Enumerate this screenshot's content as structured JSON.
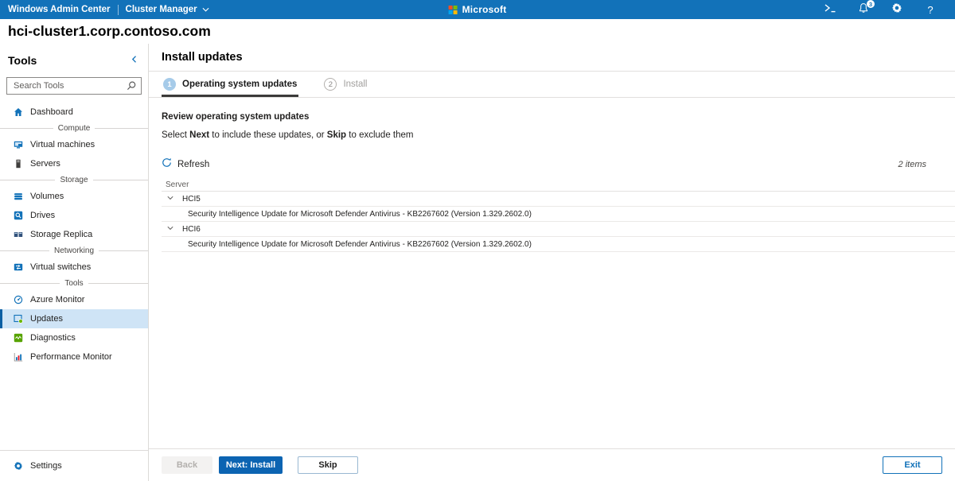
{
  "colors": {
    "topbar_blue": "#1272b9",
    "primary_button_blue": "#0c64b2",
    "selected_item_bg": "#cfe4f6",
    "selected_item_bar": "#0b5fa3",
    "active_step_circle": "#a6cbe9",
    "diagnostics_green": "#57a300",
    "updates_dot_green": "#6bb700"
  },
  "topbar": {
    "app_title": "Windows Admin Center",
    "solution": "Cluster Manager",
    "brand": "Microsoft",
    "notification_count": "3",
    "help_glyph": "?"
  },
  "page": {
    "cluster_name": "hci-cluster1.corp.contoso.com"
  },
  "sidebar": {
    "title": "Tools",
    "search_placeholder": "Search Tools",
    "sections": [
      {
        "label": "",
        "items": [
          {
            "label": "Dashboard",
            "icon": "home-icon"
          }
        ]
      },
      {
        "label": "Compute",
        "items": [
          {
            "label": "Virtual machines",
            "icon": "virtual-machine-icon"
          },
          {
            "label": "Servers",
            "icon": "server-icon"
          }
        ]
      },
      {
        "label": "Storage",
        "items": [
          {
            "label": "Volumes",
            "icon": "volumes-icon"
          },
          {
            "label": "Drives",
            "icon": "drives-icon"
          },
          {
            "label": "Storage Replica",
            "icon": "storage-replica-icon"
          }
        ]
      },
      {
        "label": "Networking",
        "items": [
          {
            "label": "Virtual switches",
            "icon": "virtual-switch-icon"
          }
        ]
      },
      {
        "label": "Tools",
        "items": [
          {
            "label": "Azure Monitor",
            "icon": "azure-monitor-icon"
          },
          {
            "label": "Updates",
            "icon": "updates-icon",
            "selected": true
          },
          {
            "label": "Diagnostics",
            "icon": "diagnostics-icon"
          },
          {
            "label": "Performance Monitor",
            "icon": "performance-monitor-icon"
          }
        ]
      }
    ],
    "settings_label": "Settings"
  },
  "main": {
    "title": "Install updates",
    "steps": [
      {
        "number": "1",
        "label": "Operating system updates",
        "active": true
      },
      {
        "number": "2",
        "label": "Install",
        "active": false
      }
    ],
    "section_title": "Review operating system updates",
    "instruction_parts": [
      {
        "text": "Select ",
        "bold": false
      },
      {
        "text": "Next",
        "bold": true
      },
      {
        "text": " to include these updates, or ",
        "bold": false
      },
      {
        "text": "Skip",
        "bold": true
      },
      {
        "text": " to exclude them",
        "bold": false
      }
    ],
    "refresh_label": "Refresh",
    "items_count": "2 items",
    "table": {
      "column_header": "Server",
      "groups": [
        {
          "server": "HCI5",
          "updates": [
            "Security Intelligence Update for Microsoft Defender Antivirus - KB2267602 (Version 1.329.2602.0)"
          ]
        },
        {
          "server": "HCI6",
          "updates": [
            "Security Intelligence Update for Microsoft Defender Antivirus - KB2267602 (Version 1.329.2602.0)"
          ]
        }
      ]
    },
    "footer": {
      "back": "Back",
      "next": "Next: Install",
      "skip": "Skip",
      "exit": "Exit"
    }
  }
}
